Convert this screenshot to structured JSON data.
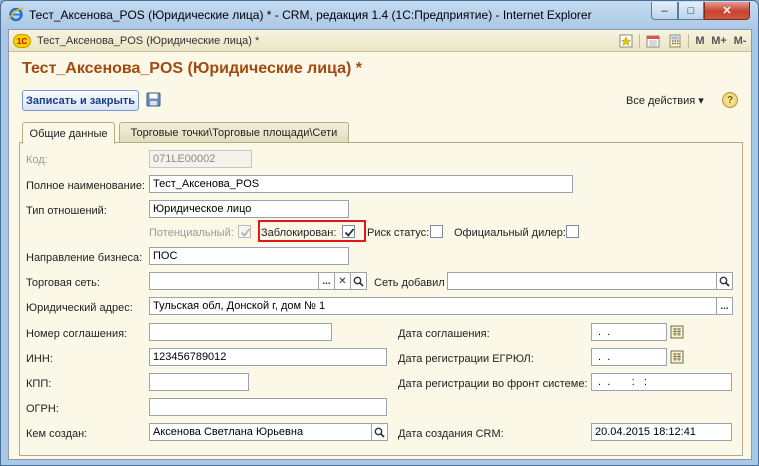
{
  "window": {
    "title": "Тест_Аксенова_POS (Юридические лица) * - CRM, редакция 1.4 (1С:Предприятие) - Internet Explorer"
  },
  "appbar": {
    "tab_title": "Тест_Аксенова_POS (Юридические лица) *",
    "m": "M",
    "m_plus": "M+",
    "m_minus": "M-"
  },
  "form": {
    "title": "Тест_Аксенова_POS (Юридические лица) *",
    "save_close": "Записать и закрыть",
    "all_actions": "Все действия",
    "help": "?",
    "tabs": [
      "Общие данные",
      "Торговые точки\\Торговые площади\\Сети"
    ]
  },
  "fields": {
    "code_label": "Код:",
    "code_value": "071LE00002",
    "fullname_label": "Полное наименование:",
    "fullname_value": "Тест_Аксенова_POS",
    "relation_label": "Тип отношений:",
    "relation_value": "Юридическое лицо",
    "potential_label": "Потенциальный:",
    "potential_checked": true,
    "blocked_label": "Заблокирован:",
    "blocked_checked": true,
    "risk_label": "Риск статус:",
    "risk_checked": false,
    "dealer_label": "Официальный дилер:",
    "dealer_checked": false,
    "direction_label": "Направление бизнеса:",
    "direction_value": "ПОС",
    "network_label": "Торговая сеть:",
    "network_value": "",
    "network_added_label": "Сеть добавил",
    "network_added_value": "",
    "address_label": "Юридический адрес:",
    "address_value": "Тульская обл, Донской г, дом № 1",
    "agreement_label": "Номер соглашения:",
    "agreement_value": "",
    "agreement_date_label": "Дата соглашения:",
    "agreement_date_value": " .  .",
    "inn_label": "ИНН:",
    "inn_value": "123456789012",
    "egrul_label": "Дата регистрации ЕГРЮЛ:",
    "egrul_value": " .  .",
    "kpp_label": "КПП:",
    "kpp_value": "",
    "front_label": "Дата регистрации во фронт системе:",
    "front_value": " .  .       :   :",
    "ogrn_label": "ОГРН:",
    "ogrn_value": "",
    "created_by_label": "Кем создан:",
    "created_by_value": "Аксенова Светлана Юрьевна",
    "created_date_label": "Дата создания CRM:",
    "created_date_value": "20.04.2015 18:12:41"
  },
  "glyphs": {
    "ellipsis": "...",
    "clear": "✕",
    "close": "✕",
    "minimize": "–",
    "maximize": "□",
    "dropdown": "▾"
  },
  "colors": {
    "title_accent": "#a24a10",
    "highlight_box": "#e01818"
  }
}
